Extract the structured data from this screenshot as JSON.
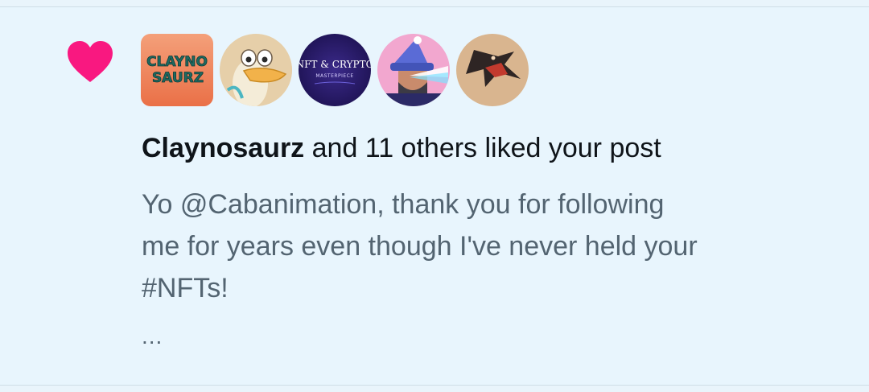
{
  "notification": {
    "type_icon": "heart-icon",
    "accent_color": "#f91880",
    "avatars": [
      {
        "name": "claynosaurz-avatar",
        "label_line1": "CLAYNO",
        "label_line2": "SAURZ"
      },
      {
        "name": "duck-avatar"
      },
      {
        "name": "nft-crypto-avatar",
        "label_line1": "NFT & CRYPTO",
        "label_line2": "MASTERPIECE"
      },
      {
        "name": "wizard-avatar"
      },
      {
        "name": "pterodactyl-avatar"
      }
    ],
    "headline": {
      "actor": "Claynosaurz",
      "rest": " and 11 others liked your post"
    },
    "post_line1": "Yo @Cabanimation, thank you for following",
    "post_line2": "me for years even though I've never held your",
    "post_line3": "#NFTs!",
    "more": "..."
  }
}
